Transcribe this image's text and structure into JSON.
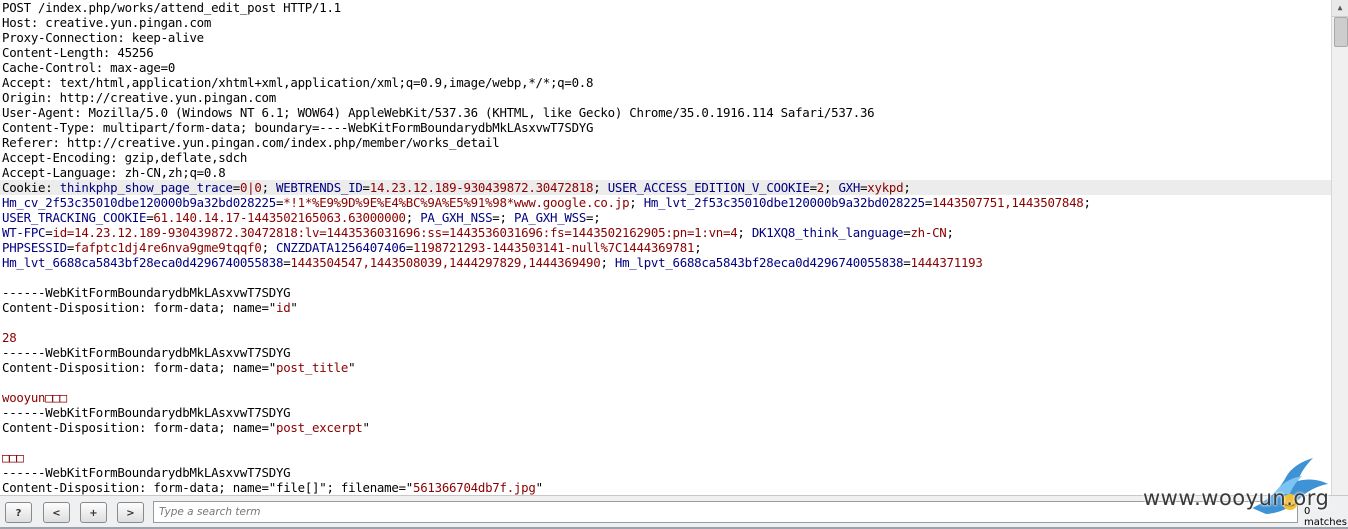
{
  "request": {
    "request_line": "POST /index.php/works/attend_edit_post HTTP/1.1",
    "host": "Host: creative.yun.pingan.com",
    "proxy_connection": "Proxy-Connection: keep-alive",
    "content_length": "Content-Length: 45256",
    "cache_control": "Cache-Control: max-age=0",
    "accept": "Accept: text/html,application/xhtml+xml,application/xml;q=0.9,image/webp,*/*;q=0.8",
    "origin": "Origin: http://creative.yun.pingan.com",
    "user_agent": "User-Agent: Mozilla/5.0 (Windows NT 6.1; WOW64) AppleWebKit/537.36 (KHTML, like Gecko) Chrome/35.0.1916.114 Safari/537.36",
    "content_type": "Content-Type: multipart/form-data; boundary=----WebKitFormBoundarydbMkLAsxvwT7SDYG",
    "referer": "Referer: http://creative.yun.pingan.com/index.php/member/works_detail",
    "accept_encoding": "Accept-Encoding: gzip,deflate,sdch",
    "accept_language": "Accept-Language: zh-CN,zh;q=0.8"
  },
  "cookie": {
    "label": "Cookie: ",
    "pairs": [
      {
        "k": "thinkphp_show_page_trace",
        "v": "0|0",
        "sep": "; "
      },
      {
        "k": "WEBTRENDS_ID",
        "v": "14.23.12.189-930439872.30472818",
        "sep": "; "
      },
      {
        "k": "USER_ACCESS_EDITION_V_COOKIE",
        "v": "2",
        "sep": "; "
      },
      {
        "k": "GXH",
        "v": "xykpd",
        "sep": ";"
      },
      {
        "k": "Hm_cv_2f53c35010dbe120000b9a32bd028225",
        "v": "*!1*%E9%9D%9E%E4%BC%9A%E5%91%98*www.google.co.jp",
        "sep": "; "
      },
      {
        "k": "Hm_lvt_2f53c35010dbe120000b9a32bd028225",
        "v": "1443507751,1443507848",
        "sep": ";"
      },
      {
        "k": "USER_TRACKING_COOKIE",
        "v": "61.140.14.17-1443502165063.63000000",
        "sep": "; "
      },
      {
        "k": "PA_GXH_NSS",
        "v": "",
        "sep": "; "
      },
      {
        "k": "PA_GXH_WSS",
        "v": "",
        "sep": ";"
      },
      {
        "k": "WT-FPC",
        "v": "id=14.23.12.189-930439872.30472818:lv=1443536031696:ss=1443536031696:fs=1443502162905:pn=1:vn=4",
        "sep": "; "
      },
      {
        "k": "DK1XQ8_think_language",
        "v": "zh-CN",
        "sep": ";"
      },
      {
        "k": "PHPSESSID",
        "v": "fafptc1dj4re6nva9gme9tqqf0",
        "sep": "; "
      },
      {
        "k": "CNZZDATA1256407406",
        "v": "1198721293-1443503141-null%7C1444369781",
        "sep": ";"
      },
      {
        "k": "Hm_lvt_6688ca5843bf28eca0d4296740055838",
        "v": "1443504547,1443508039,1444297829,1444369490",
        "sep": "; "
      },
      {
        "k": "Hm_lpvt_6688ca5843bf28eca0d4296740055838",
        "v": "1444371193",
        "sep": ""
      }
    ]
  },
  "body": {
    "boundary": "------WebKitFormBoundarydbMkLAsxvwT7SDYG",
    "disp_prefix": "Content-Disposition: form-data; name=",
    "q": "\"",
    "part1_name": "id",
    "part1_value": "28",
    "part2_name": "post_title",
    "part2_value": "wooyun□□□",
    "part3_name": "post_excerpt",
    "part3_value": "□□□",
    "part4_name": "file[]",
    "part4_mid": "; filename=",
    "part4_filename": "561366704db7f.jpg"
  },
  "toolbar": {
    "help_label": "?",
    "prev_label": "<",
    "add_label": "+",
    "next_label": ">",
    "search_placeholder": "Type a search term",
    "matches": "0 matches"
  },
  "watermark": {
    "text": "www.wooyun.org"
  },
  "colors": {
    "key": "#000080",
    "value": "#8b0000",
    "highlight": "#ececec"
  }
}
